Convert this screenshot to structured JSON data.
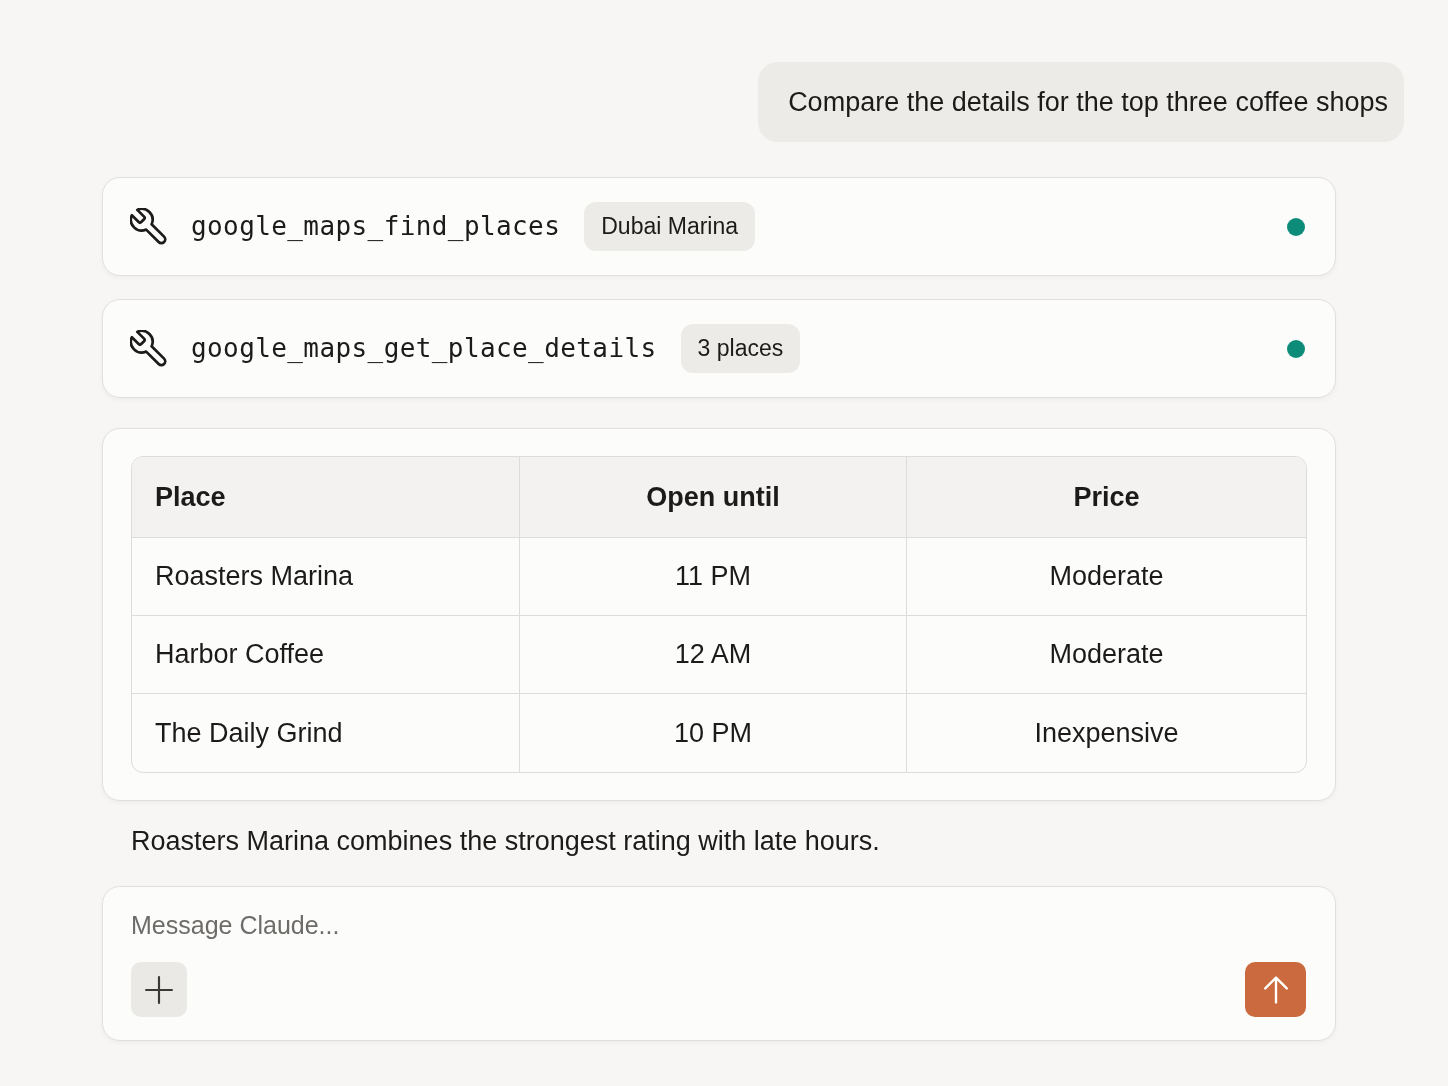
{
  "user_message": {
    "text": "Compare the details for the top three coffee shops"
  },
  "tool_calls": [
    {
      "name": "google_maps_find_places",
      "argument": "Dubai Marina",
      "color": "#0e8c7a"
    },
    {
      "name": "google_maps_get_place_details",
      "argument": "3 places",
      "color": "#0e8c7a"
    }
  ],
  "results_table": {
    "columns": [
      "Place",
      "Open until",
      "Price"
    ],
    "rows": [
      [
        "Roasters Marina",
        "11 PM",
        "Moderate"
      ],
      [
        "Harbor Coffee",
        "12 AM",
        "Moderate"
      ],
      [
        "The Daily Grind",
        "10 PM",
        "Inexpensive"
      ]
    ]
  },
  "answer": "Roasters Marina combines the strongest rating with late hours.",
  "composer": {
    "placeholder": "Message Claude..."
  }
}
